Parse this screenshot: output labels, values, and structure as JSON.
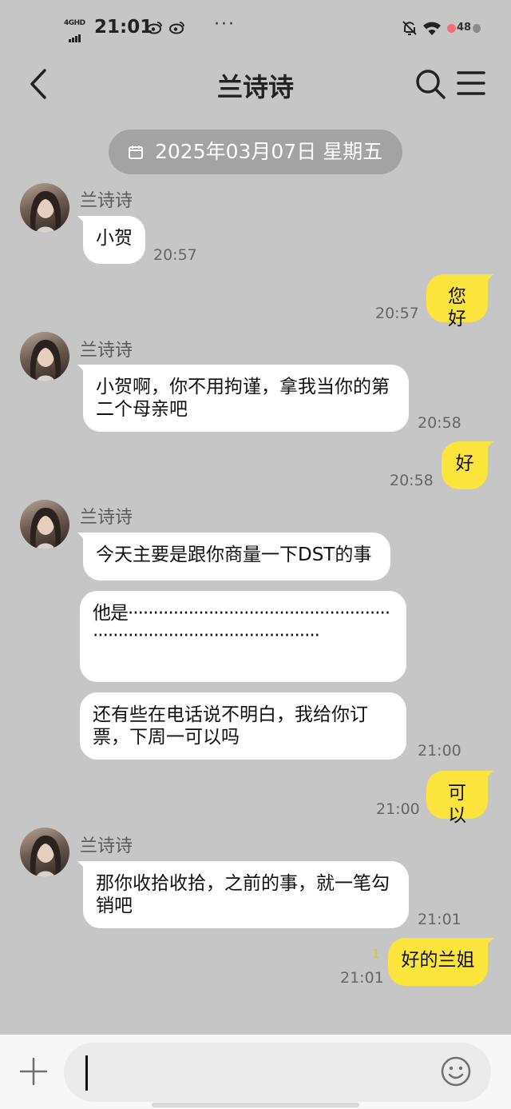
{
  "status_bar": {
    "network": "4GHD",
    "time": "21:01",
    "overflow": "···",
    "battery": "48",
    "icons": [
      "weibo-icon",
      "weibo-icon",
      "bell-off-icon",
      "wifi-icon",
      "battery-icon"
    ]
  },
  "header": {
    "title": "兰诗诗",
    "icons": [
      "back-icon",
      "search-icon",
      "menu-icon"
    ]
  },
  "date_divider": "2025年03月07日 星期五",
  "contact_name": "兰诗诗",
  "messages": [
    {
      "from": "contact",
      "sender": "兰诗诗",
      "text": "小贺",
      "time": "20:57"
    },
    {
      "from": "me",
      "text": "您好",
      "time": "20:57"
    },
    {
      "from": "contact",
      "sender": "兰诗诗",
      "text": "小贺啊，你不用拘谨，拿我当你的第二个母亲吧",
      "time": "20:58"
    },
    {
      "from": "me",
      "text": "好",
      "time": "20:58"
    },
    {
      "from": "contact",
      "sender": "兰诗诗",
      "text": "今天主要是跟你商量一下DST的事",
      "time": ""
    },
    {
      "from": "contact",
      "sender": "",
      "text": "他是·································································································",
      "time": ""
    },
    {
      "from": "contact",
      "sender": "",
      "text": "还有些在电话说不明白，我给你订票，下周一可以吗",
      "time": "21:00"
    },
    {
      "from": "me",
      "text": "可以",
      "time": "21:00"
    },
    {
      "from": "contact",
      "sender": "兰诗诗",
      "text": "那你收拾收拾，之前的事，就一笔勾销吧",
      "time": "21:01"
    },
    {
      "from": "me",
      "text": "好的兰姐",
      "time": "21:01",
      "read_count": "1"
    }
  ],
  "input": {
    "value": "",
    "icons": [
      "plus-icon",
      "emoji-icon"
    ]
  }
}
